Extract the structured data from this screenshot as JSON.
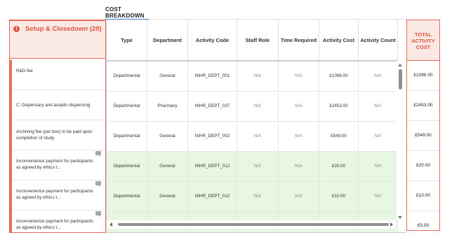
{
  "tabs": {
    "active": "COST BREAKDOWN"
  },
  "left_panel": {
    "warning_glyph": "!",
    "title": "Setup & Closedown (28)",
    "rows": [
      {
        "label": "R&D fee",
        "has_comment": false
      },
      {
        "label": "C: Dispensary and aseptic dispensing",
        "has_comment": false
      },
      {
        "label": "Archiving fee (per box) to be paid upon completion of study",
        "has_comment": false
      },
      {
        "label": "Inconvenience payment for participants as agreed by ethics t...",
        "has_comment": true
      },
      {
        "label": "Inconvenience payment for participants as agreed by ethics t...",
        "has_comment": true
      },
      {
        "label": "Inconvenience payment for participants as agreed by ethics t...",
        "has_comment": true
      }
    ]
  },
  "grid": {
    "columns": [
      "Type",
      "Department",
      "Activity Code",
      "Staff Role",
      "Time Required",
      "Activity Cost",
      "Activity Count"
    ],
    "rows": [
      {
        "type": "Departmental",
        "department": "General",
        "code": "NIHR_DEPT_001",
        "staff": "N/A",
        "time": "N/A",
        "cost": "£1096.00",
        "count": "N/A",
        "highlight": false
      },
      {
        "type": "Departmental",
        "department": "Pharmacy",
        "code": "NIHR_DEPT_037",
        "staff": "N/A",
        "time": "N/A",
        "cost": "£2453.00",
        "count": "N/A",
        "highlight": false
      },
      {
        "type": "Departmental",
        "department": "General",
        "code": "NIHR_DEPT_002",
        "staff": "N/A",
        "time": "N/A",
        "cost": "£549.00",
        "count": "N/A",
        "highlight": false
      },
      {
        "type": "Departmental",
        "department": "General",
        "code": "NIHR_DEPT_012",
        "staff": "N/A",
        "time": "N/A",
        "cost": "£20.00",
        "count": "N/A",
        "highlight": true
      },
      {
        "type": "Departmental",
        "department": "General",
        "code": "NIHR_DEPT_012",
        "staff": "N/A",
        "time": "N/A",
        "cost": "£10.00",
        "count": "N/A",
        "highlight": true
      },
      {
        "type": "",
        "department": "",
        "code": "",
        "staff": "",
        "time": "",
        "cost": "",
        "count": "",
        "highlight": true
      }
    ]
  },
  "total_panel": {
    "header_lines": [
      "TOTAL",
      "ACTIVITY",
      "COST"
    ],
    "values": [
      "£1096.00",
      "£2453.00",
      "£549.00",
      "£20.00",
      "£10.00",
      "£5.00"
    ]
  },
  "colors": {
    "accent_red": "#e5533e",
    "panel_tint": "#fbe9e6",
    "row_highlight": "#e8f7e2",
    "tab_underline": "#3f7fd0"
  }
}
